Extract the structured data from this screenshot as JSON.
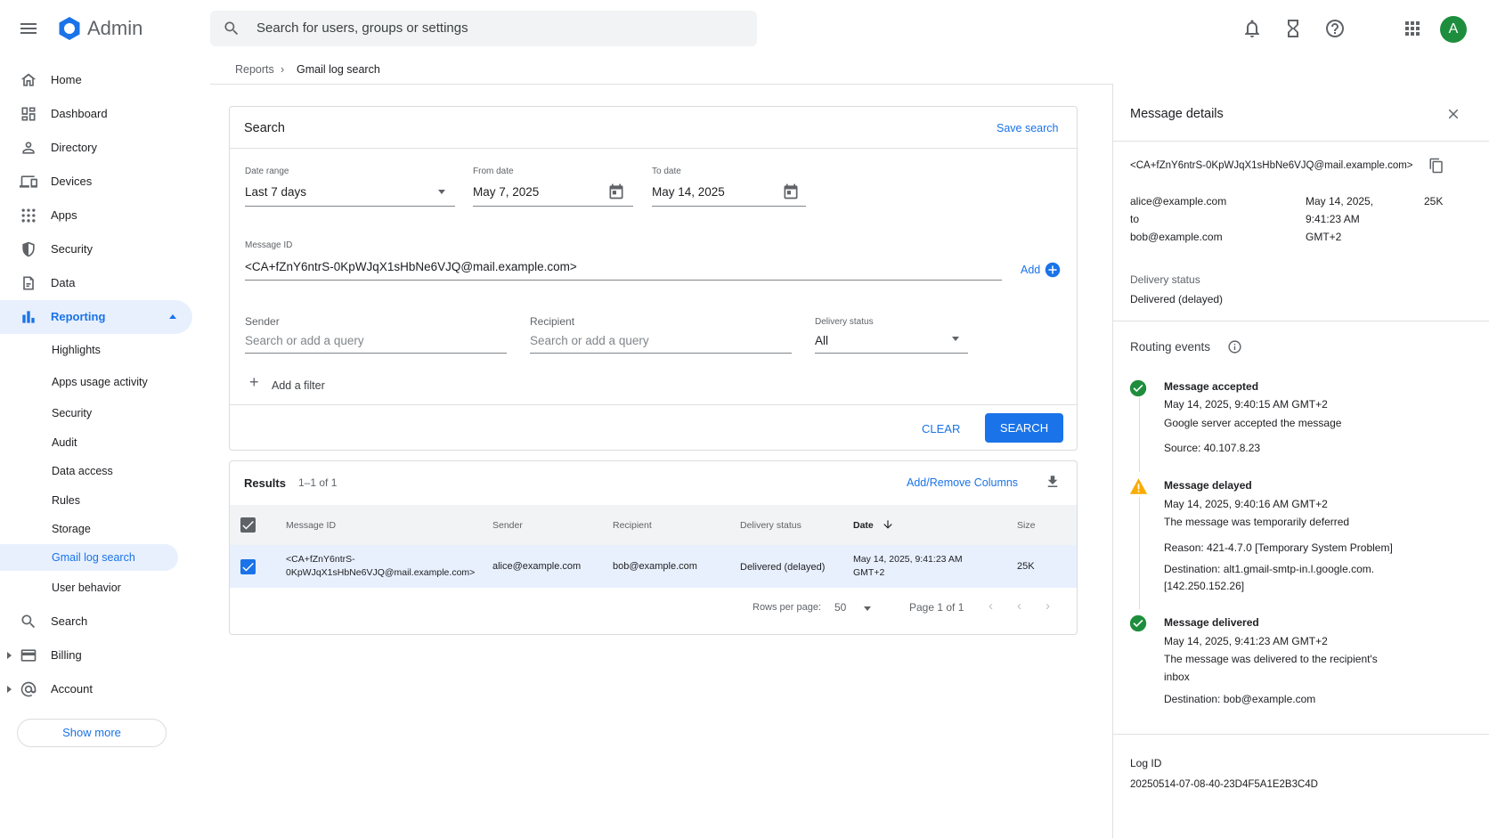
{
  "topbar": {
    "app_title": "Admin",
    "search_placeholder": "Search for users, groups or settings",
    "avatar_letter": "A"
  },
  "sidebar": {
    "items": [
      {
        "label": "Home",
        "icon": "home-icon"
      },
      {
        "label": "Dashboard",
        "icon": "dashboard-icon"
      },
      {
        "label": "Directory",
        "icon": "person-icon"
      },
      {
        "label": "Devices",
        "icon": "devices-icon"
      },
      {
        "label": "Apps",
        "icon": "apps-grid-icon"
      },
      {
        "label": "Security",
        "icon": "shield-icon"
      },
      {
        "label": "Data",
        "icon": "data-icon"
      },
      {
        "label": "Reporting",
        "icon": "bar-chart-icon"
      }
    ],
    "reporting_sub": [
      "Highlights",
      "Apps usage activity",
      "Security",
      "Audit",
      "Data access",
      "Rules",
      "Storage",
      "Gmail log search",
      "User behavior"
    ],
    "bottom_items": [
      {
        "label": "Search",
        "icon": "search-icon"
      },
      {
        "label": "Billing",
        "icon": "billing-card-icon"
      },
      {
        "label": "Account",
        "icon": "account-at-icon"
      }
    ],
    "show_more": "Show more"
  },
  "breadcrumb": {
    "parent": "Reports",
    "current": "Gmail log search"
  },
  "search_card": {
    "title": "Search",
    "save_search": "Save search",
    "date_range_label": "Date range",
    "date_range_value": "Last 7 days",
    "from_label": "From date",
    "from_value": "May 7, 2025",
    "to_label": "To date",
    "to_value": "May 14, 2025",
    "message_id_label": "Message ID",
    "message_id_value": "<CA+fZnY6ntrS-0KpWJqX1sHbNe6VJQ@mail.example.com>",
    "add_label": "Add",
    "sender_label": "Sender",
    "sender_placeholder": "Search or add a query",
    "recipient_label": "Recipient",
    "recipient_placeholder": "Search or add a query",
    "delivery_label": "Delivery status",
    "delivery_value": "All",
    "add_filter": "Add a filter",
    "clear": "CLEAR",
    "search": "SEARCH"
  },
  "results": {
    "title": "Results",
    "count": "1–1 of 1",
    "add_remove": "Add/Remove Columns",
    "columns": [
      "Message ID",
      "Sender",
      "Recipient",
      "Delivery status",
      "Date",
      "Size"
    ],
    "row": {
      "message_id_1": "<CA+fZnY6ntrS-",
      "message_id_2": "0KpWJqX1sHbNe6VJQ@mail.example.com>",
      "sender": "alice@example.com",
      "recipient": "bob@example.com",
      "status": "Delivered (delayed)",
      "date_1": "May 14, 2025, 9:41:23 AM",
      "date_2": "GMT+2",
      "size": "25K"
    },
    "rows_per_page_label": "Rows per page:",
    "rows_per_page": "50",
    "page": "Page 1 of 1"
  },
  "details": {
    "title": "Message details",
    "message_id": "<CA+fZnY6ntrS-0KpWJqX1sHbNe6VJQ@mail.example.com>",
    "from": "alice@example.com",
    "to_word": "to",
    "to": "bob@example.com",
    "date_1": "May 14, 2025,",
    "date_2": "9:41:23 AM",
    "date_3": "GMT+2",
    "size": "25K",
    "delivery_label": "Delivery status",
    "delivery_value": "Delivered (delayed)",
    "routing_title": "Routing events",
    "events": [
      {
        "title": "Message accepted",
        "time": "May 14, 2025, 9:40:15 AM GMT+2",
        "desc": "Google server accepted the message",
        "extra": "Source: 40.107.8.23"
      },
      {
        "title": "Message delayed",
        "time": "May 14, 2025, 9:40:16 AM GMT+2",
        "desc": "The message was temporarily deferred",
        "reason": "Reason: 421-4.7.0 [Temporary System Problem]",
        "dest_1": "Destination: alt1.gmail-smtp-in.l.google.com.",
        "dest_2": "[142.250.152.26]"
      },
      {
        "title": "Message delivered",
        "time": "May 14, 2025, 9:41:23 AM GMT+2",
        "desc_1": "The message was delivered to the recipient's",
        "desc_2": "inbox",
        "extra": "Destination: bob@example.com"
      }
    ],
    "log_id_label": "Log ID",
    "log_id": "20250514-07-08-40-23D4F5A1E2B3C4D"
  },
  "colors": {
    "accent": "#1a73e8",
    "success": "#1e8e3e",
    "warning": "#f9ab00"
  }
}
